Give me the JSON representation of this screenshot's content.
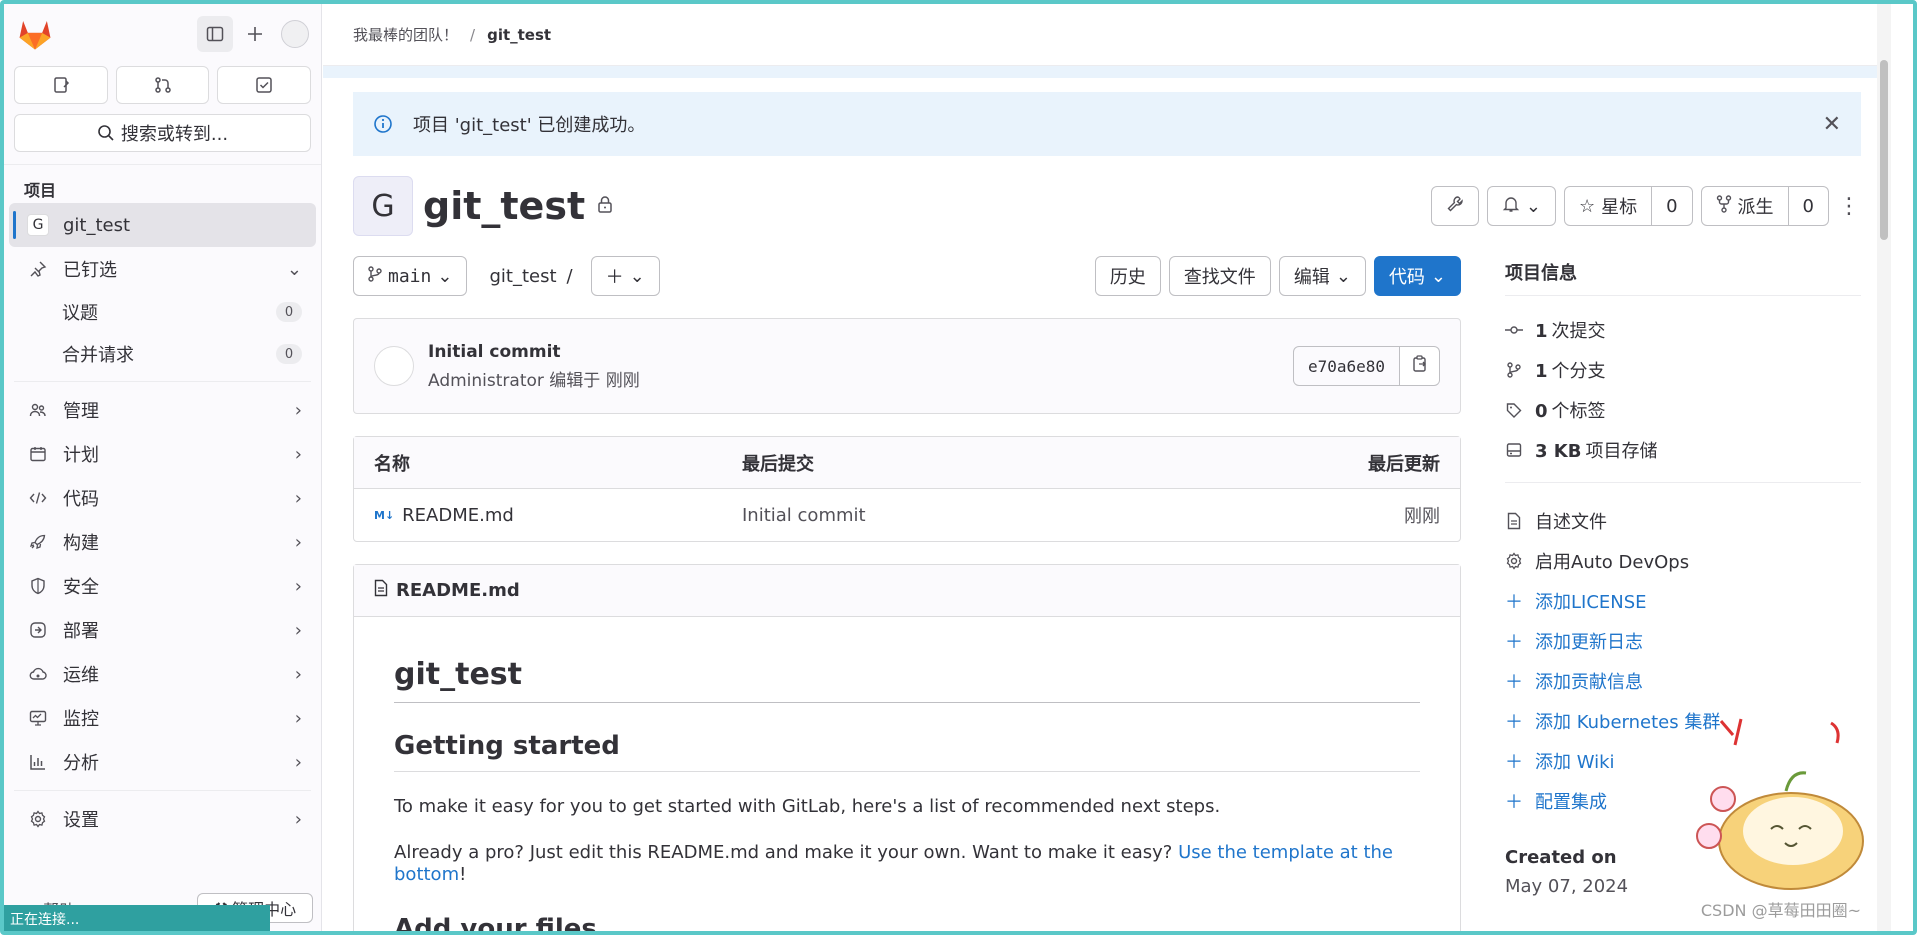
{
  "sidebar": {
    "search_label": "搜索或转到...",
    "section_label": "项目",
    "project_item": {
      "badge": "G",
      "label": "git_test"
    },
    "pinned": {
      "label": "已钉选",
      "items": [
        {
          "label": "议题",
          "count": "0"
        },
        {
          "label": "合并请求",
          "count": "0"
        }
      ]
    },
    "nav": [
      {
        "label": "管理",
        "icon": "users-icon"
      },
      {
        "label": "计划",
        "icon": "calendar-icon"
      },
      {
        "label": "代码",
        "icon": "code-icon"
      },
      {
        "label": "构建",
        "icon": "rocket-icon"
      },
      {
        "label": "安全",
        "icon": "shield-icon"
      },
      {
        "label": "部署",
        "icon": "deploy-icon"
      },
      {
        "label": "运维",
        "icon": "cloud-icon"
      },
      {
        "label": "监控",
        "icon": "monitor-icon"
      },
      {
        "label": "分析",
        "icon": "chart-icon"
      }
    ],
    "settings_label": "设置",
    "help_label": "帮助",
    "admin_label": "管理中心"
  },
  "status_bar": "正在连接...",
  "breadcrumb": {
    "group": "我最棒的团队！",
    "project": "git_test"
  },
  "alert": {
    "message": "项目 'git_test' 已创建成功。"
  },
  "project": {
    "avatar": "G",
    "title": "git_test"
  },
  "header_actions": {
    "star_label": "星标",
    "star_count": "0",
    "fork_label": "派生",
    "fork_count": "0"
  },
  "repo_bar": {
    "branch": "main",
    "path": "git_test",
    "slash": "/",
    "history": "历史",
    "find_file": "查找文件",
    "edit": "编辑",
    "code": "代码"
  },
  "commit": {
    "title": "Initial commit",
    "author": "Administrator",
    "meta": "编辑于 刚刚",
    "sha": "e70a6e80"
  },
  "file_table": {
    "headers": [
      "名称",
      "最后提交",
      "最后更新"
    ],
    "rows": [
      {
        "name": "README.md",
        "commit": "Initial commit",
        "updated": "刚刚"
      }
    ]
  },
  "readme": {
    "filename": "README.md",
    "h1": "git_test",
    "h2a": "Getting started",
    "p1": "To make it easy for you to get started with GitLab, here's a list of recommended next steps.",
    "p2_text": "Already a pro? Just edit this README.md and make it your own. Want to make it easy? ",
    "p2_link": "Use the template at the bottom",
    "p2_end": "!",
    "h2b": "Add your files"
  },
  "project_info": {
    "title": "项目信息",
    "stats": [
      {
        "num": "1",
        "label": "次提交",
        "icon": "commit-icon"
      },
      {
        "num": "1",
        "label": "个分支",
        "icon": "branch-icon"
      },
      {
        "num": "0",
        "label": "个标签",
        "icon": "tag-icon"
      },
      {
        "num": "3 KB",
        "label": "项目存储",
        "icon": "storage-icon"
      }
    ],
    "actions": [
      {
        "label": "自述文件",
        "icon": "doc-icon"
      },
      {
        "label": "启用Auto DevOps",
        "icon": "gear-icon"
      }
    ],
    "links": [
      "添加LICENSE",
      "添加更新日志",
      "添加贡献信息",
      "添加 Kubernetes 集群",
      "添加 Wiki",
      "配置集成"
    ],
    "created_label": "Created on",
    "created_date": "May 07, 2024"
  },
  "watermark": "CSDN @草莓田田圈~",
  "colors": {
    "accent": "#1f75cb",
    "alert_bg": "#e9f3fc",
    "logo": "#e24329"
  }
}
